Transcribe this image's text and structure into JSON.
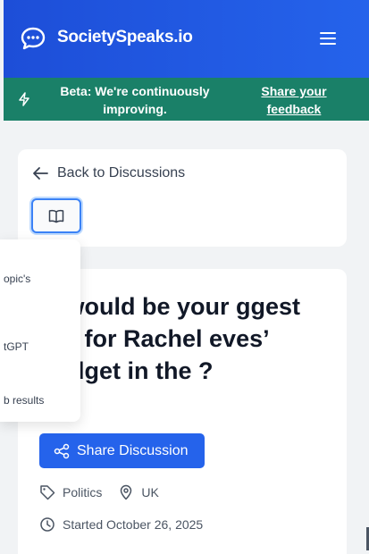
{
  "nav": {
    "brand": "SocietySpeaks.io"
  },
  "banner": {
    "text": "Beta: We're continuously improving.",
    "link": "Share your feedback"
  },
  "toolbar": {
    "back_label": "Back to Discussions"
  },
  "dropdown": {
    "items": [
      "opic's",
      "tGPT",
      "b results"
    ]
  },
  "discussion": {
    "title": "at would be your ggest win for Rachel eves’ Budget in the ?",
    "share_label": "Share Discussion",
    "topic": "Politics",
    "location": "UK",
    "started": "Started October 26, 2025"
  },
  "colors": {
    "nav": "#2563eb",
    "banner": "#1a8068",
    "button": "#2563eb"
  }
}
